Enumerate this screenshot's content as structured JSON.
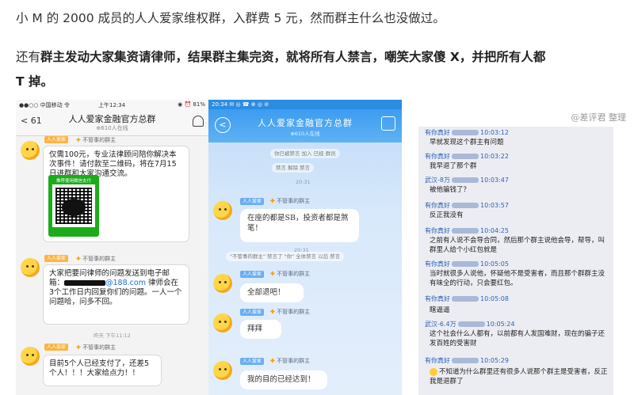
{
  "article": {
    "line1": "小 M 的 2000 成员的人人爱家维权群，入群费 5 元，然而群主什么也没做过。",
    "line2_prefix": "还有",
    "line2_bold": "群主发动大家集资请律师，结果群主集完资，就将所有人禁言，嘲笑大家傻 X，并把所有人都",
    "line3_bold": "T 掉。"
  },
  "panel_a": {
    "status_carrier": "●●○○ 中国移动 令",
    "status_time": "上午12:34",
    "status_battery": "◉ ⏰ 81%",
    "back_label": "< 61",
    "title": "人人爱家金融官方总群",
    "subtitle": "⊕610人在线",
    "tag": "人人爱家",
    "sender_name": "不管事的群主",
    "messages": [
      "仅需100元，专业法律顾问陪你解决本次事件！请付款至二维码，将在7月15日进群和大家沟通交流。",
      "大家把要问律师的问题发送到电子邮箱：",
      "@188.com",
      " 律师会在3个工作日内回复你们的问题。一人一个问题哈，问多不回。",
      "目前5个人已经支付了，还差5个人！！！大家给点力！！"
    ],
    "pay_title": "推荐使用微信支付",
    "timestamp": "昨天 下午11:12"
  },
  "panel_b": {
    "status_text": "20:34 ✉ ◎ ☎ ⊕ ◎ ⊘",
    "title": "人人爱家金融官方总群",
    "subtitle": "⊕610人在线",
    "pill_1": "你已被禁言 加入 已经 群员",
    "pill_2": "禁言 解除 禁言",
    "time_1": "20:31",
    "time_2": "20:31",
    "pill_3": "\"不管事的群主\" 禁言了 \"你\" 全体禁言 以后 禁言",
    "sender_name": "不管事的群主",
    "tag": "人人爱家",
    "messages": [
      "在座的都是SB，投资者都是煞笔！",
      "全部退吧！",
      "拜拜",
      "我的目的已经达到！"
    ]
  },
  "panel_c": {
    "credit": "@差评君 整理",
    "entries": [
      {
        "name": "有你真好",
        "time": "10:03:12",
        "text": "早就发现这个群主有问题"
      },
      {
        "name": "有你真好",
        "time": "10:03:22",
        "text": "我早退了那个群"
      },
      {
        "name": "武汉-8万",
        "time": "10:03:47",
        "text": "被他骗钱了？"
      },
      {
        "name": "有你真好",
        "time": "10:03:57",
        "text": "反正我没有"
      },
      {
        "name": "有你真好",
        "time": "10:04:25",
        "text": "之前有人说不会导合同，然后那个群主说他会导，帮导，叫群里人给个小红包就是"
      },
      {
        "name": "有你真好",
        "time": "10:05:05",
        "text": "当时就很多人说他，怀疑他不是受害者，而且那个群群主没有味全的行动，只会要红包。"
      },
      {
        "name": "有你真好",
        "time": "10:05:08",
        "text": "瞎逼逼"
      },
      {
        "name": "武汉-6.4万",
        "time": "10:05:24",
        "text": "这个社会什么人都有，以前都有人发国难财，现在的骗子还发百姓的受害财"
      },
      {
        "name": "有你真好",
        "time": "10:05:29",
        "text": "不知道为什么群里还有很多人说那个群主是受害者，反正我是退群了"
      }
    ]
  },
  "colors": {
    "qq_blue": "#3c9cf0",
    "wechat_green": "#1aad19",
    "log_name": "#2a5fb8"
  }
}
